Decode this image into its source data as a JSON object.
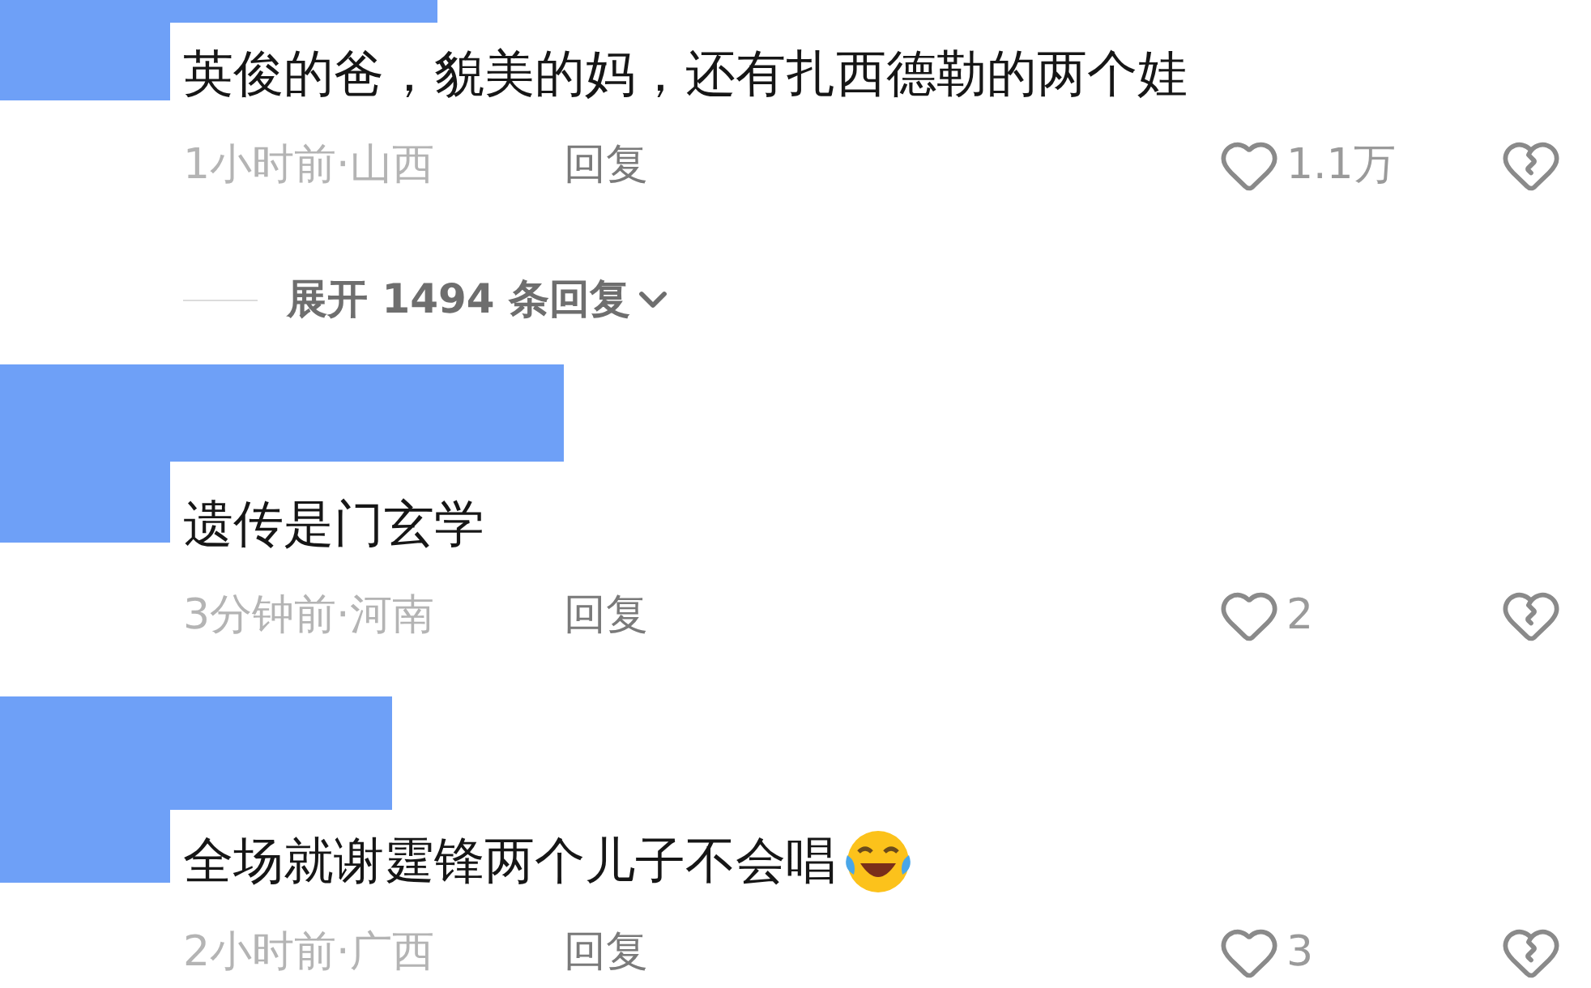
{
  "comments": [
    {
      "text": "英俊的爸，貌美的妈，还有扎西德勒的两个娃",
      "has_emoji": false,
      "meta": "1小时前·山西",
      "reply": "回复",
      "likes": "1.1万",
      "expand": "展开 1494 条回复"
    },
    {
      "text": "遗传是门玄学",
      "has_emoji": false,
      "meta": "3分钟前·河南",
      "reply": "回复",
      "likes": "2"
    },
    {
      "text": "全场就谢霆锋两个儿子不会唱",
      "has_emoji": true,
      "meta": "2小时前·广西",
      "reply": "回复",
      "likes": "3"
    }
  ]
}
